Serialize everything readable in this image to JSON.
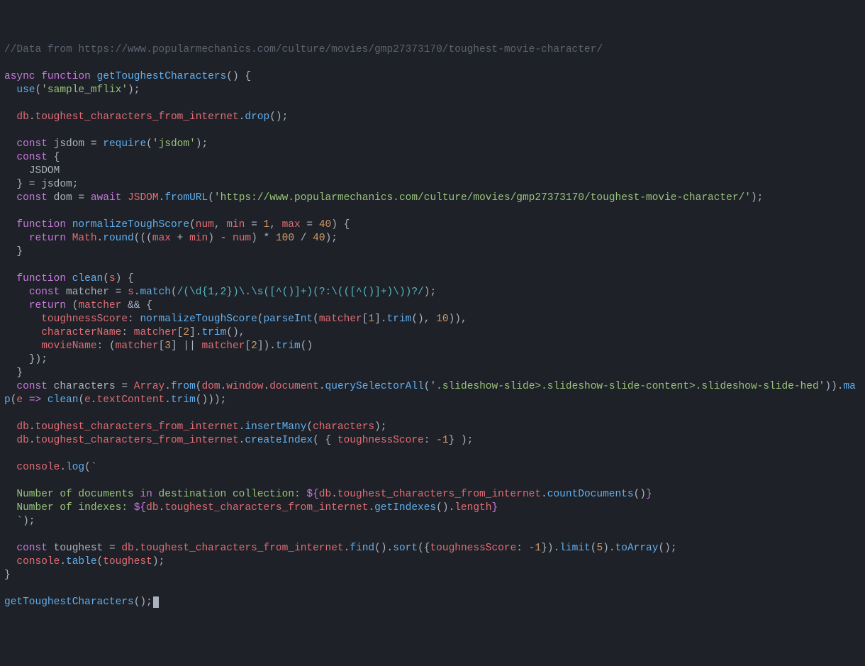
{
  "comment": "//Data from https://www.popularmechanics.com/culture/movies/gmp27373170/toughest-movie-character/",
  "fnDecl": {
    "async": "async",
    "function": "function",
    "name": "getToughestCharacters"
  },
  "useCall": {
    "fn": "use",
    "arg": "'sample_mflix'"
  },
  "dropLine": {
    "db": "db",
    "coll": "toughest_characters_from_internet",
    "drop": "drop"
  },
  "jsdomReq": {
    "const": "const",
    "var": "jsdom",
    "require": "require",
    "arg": "'jsdom'"
  },
  "destruct": {
    "const": "const",
    "JSDOM": "JSDOM",
    "eq": "jsdom"
  },
  "domLine": {
    "const": "const",
    "var": "dom",
    "await": "await",
    "JSDOM": "JSDOM",
    "fromURL": "fromURL",
    "url": "'https://www.popularmechanics.com/culture/movies/gmp27373170/toughest-movie-character/'"
  },
  "normFn": {
    "function": "function",
    "name": "normalizeToughScore",
    "params": "num, min = 1, max = 40",
    "return": "return",
    "math": "Math",
    "round": "round",
    "expr_a": "(((max + min) - num) * ",
    "hundred": "100",
    "div": " / ",
    "forty": "40",
    ")": ")"
  },
  "cleanFn": {
    "function": "function",
    "name": "clean",
    "param": "s",
    "const": "const",
    "matcher": "matcher",
    "match": "match",
    "regex": "/(\\d{1,2})\\.\\s([^()]+)(?:\\(([^()]+)\\))?/",
    "return": "return",
    "toughnessScore": "toughnessScore",
    "normalizeToughScore": "normalizeToughScore",
    "parseInt": "parseInt",
    "m1": "matcher",
    "idx1": "1",
    "trim": "trim",
    "ten": "10",
    "characterName": "characterName",
    "idx2": "2",
    "movieName": "movieName",
    "idx3": "3"
  },
  "charsLine": {
    "const": "const",
    "characters": "characters",
    "Array": "Array",
    "from": "from",
    "path": "dom.window.document.",
    "qsa": "querySelectorAll",
    "selector": "'.slideshow-slide>.slideshow-slide-content>.slideshow-slide-hed'",
    "map": "map",
    "arrow": "e => ",
    "clean": "clean",
    "rest": "(e.textContent.",
    "trim": "trim",
    "tail": "()));"
  },
  "insertLine": {
    "db": "db",
    "coll": "toughest_characters_from_internet",
    "insertMany": "insertMany",
    "arg": "characters"
  },
  "indexLine": {
    "db": "db",
    "coll": "toughest_characters_from_internet",
    "createIndex": "createIndex",
    "key": "toughnessScore",
    "val": "-1"
  },
  "log": {
    "console": "console",
    "log": "log",
    "tick": "`",
    "l1a": "Number of documents ",
    "in": "in",
    "l1b": " destination collection: ",
    "interp1_a": "db.toughest_characters_from_internet.",
    "count": "countDocuments",
    "l2a": "Number of indexes: ",
    "interp2_a": "db.toughest_characters_from_internet.",
    "getIdx": "getIndexes",
    "len": "length"
  },
  "toughest": {
    "const": "const",
    "var": "toughest",
    "db": "db",
    "coll": "toughest_characters_from_internet",
    "find": "find",
    "sort": "sort",
    "key": "toughnessScore",
    "val": "-1",
    "limit": "limit",
    "five": "5",
    "toArray": "toArray"
  },
  "table": {
    "console": "console",
    "fn": "table",
    "arg": "toughest"
  },
  "call": {
    "name": "getToughestCharacters"
  }
}
